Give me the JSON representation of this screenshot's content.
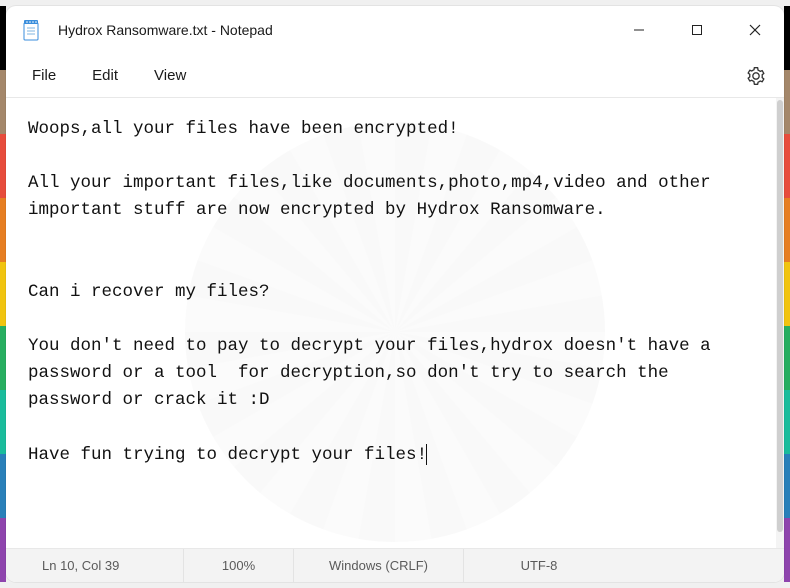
{
  "window": {
    "title": "Hydrox Ransomware.txt - Notepad"
  },
  "menu": {
    "file": "File",
    "edit": "Edit",
    "view": "View"
  },
  "content": {
    "body": "Woops,all your files have been encrypted!\n\nAll your important files,like documents,photo,mp4,video and other important stuff are now encrypted by Hydrox Ransomware.\n\n\nCan i recover my files?\n\nYou don't need to pay to decrypt your files,hydrox doesn't have a password or a tool  for decryption,so don't try to search the password or crack it :D\n\nHave fun trying to decrypt your files!"
  },
  "status": {
    "position": "Ln 10, Col 39",
    "zoom": "100%",
    "line_ending": "Windows (CRLF)",
    "encoding": "UTF-8"
  },
  "icons": {
    "notepad": "notepad-icon",
    "minimize": "minimize-icon",
    "maximize": "maximize-icon",
    "close": "close-icon",
    "settings": "gear-icon"
  },
  "colors": {
    "accent": "#0078d4",
    "text": "#111111",
    "chrome_bg": "#ffffff",
    "status_bg": "#f3f3f3"
  },
  "stripes": {
    "left": [
      "#000000",
      "#a4876a",
      "#e74c3c",
      "#e67e22",
      "#f1c40f",
      "#27ae60",
      "#1abc9c",
      "#2980b9",
      "#8e44ad"
    ],
    "right": [
      "#000000",
      "#a4876a",
      "#e74c3c",
      "#e67e22",
      "#f1c40f",
      "#27ae60",
      "#1abc9c",
      "#2980b9",
      "#8e44ad"
    ]
  }
}
